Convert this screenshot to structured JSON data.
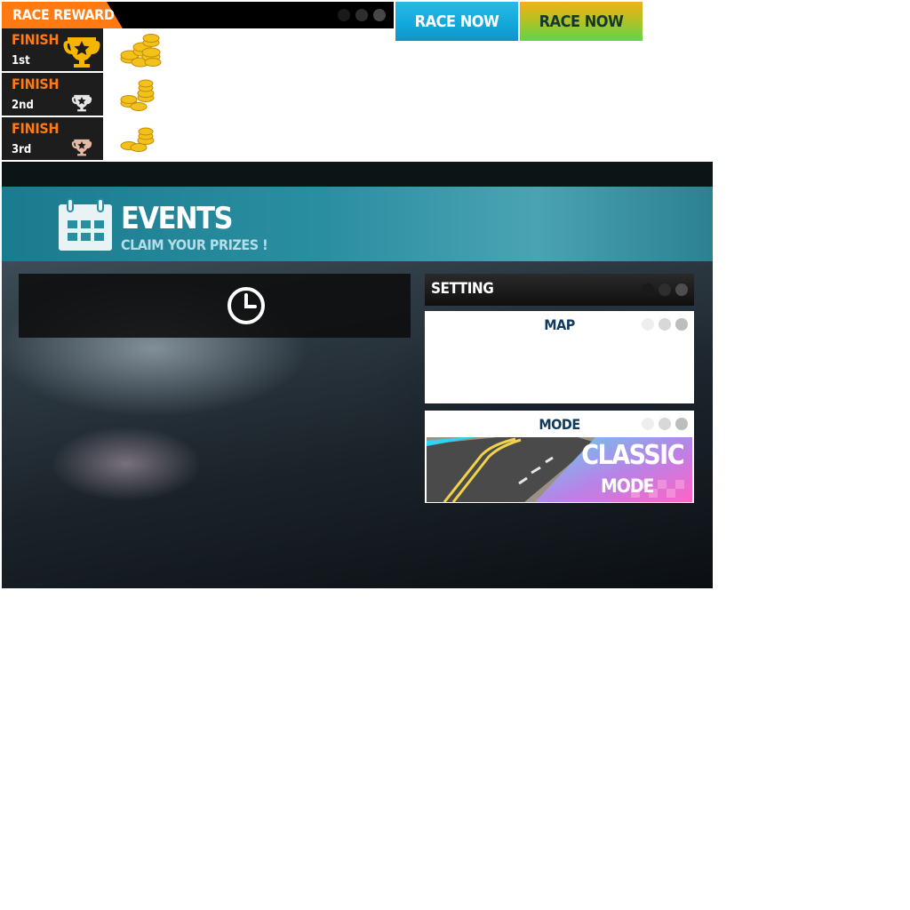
{
  "race_reward": {
    "title": "RACE REWARD",
    "finishes": [
      {
        "label": "FINISH",
        "position": "1st",
        "trophy": "gold-trophy-icon"
      },
      {
        "label": "FINISH",
        "position": "2nd",
        "trophy": "silver-trophy-icon"
      },
      {
        "label": "FINISH",
        "position": "3rd",
        "trophy": "bronze-trophy-icon"
      }
    ]
  },
  "buttons": {
    "race_now_blue": "RACE NOW",
    "race_now_green": "RACE NOW"
  },
  "events": {
    "title": "EVENTS",
    "subtitle": "CLAIM YOUR PRIZES !"
  },
  "setting": {
    "title": "SETTING",
    "map_title": "MAP",
    "mode_title": "MODE",
    "mode_line1": "CLASSIC",
    "mode_line2": "MODE"
  },
  "colors": {
    "accent_orange": "#ff7a12",
    "race_blue": "#13a9dc",
    "race_green_top": "#f2b01a",
    "race_green_bottom": "#5ed64b",
    "events_teal": "#2a8ea1",
    "title_navy": "#123a5c"
  }
}
